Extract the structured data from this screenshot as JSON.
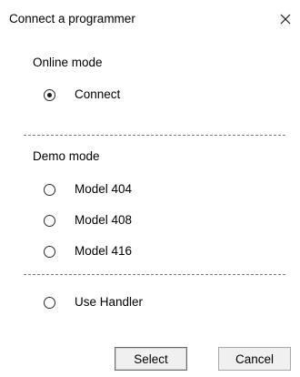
{
  "window": {
    "title": "Connect a programmer",
    "close_glyph": "✕"
  },
  "online": {
    "heading": "Online mode",
    "options": [
      {
        "label": "Connect",
        "selected": true
      }
    ]
  },
  "demo": {
    "heading": "Demo mode",
    "options": [
      {
        "label": "Model 404",
        "selected": false
      },
      {
        "label": "Model 408",
        "selected": false
      },
      {
        "label": "Model 416",
        "selected": false
      }
    ]
  },
  "handler": {
    "label": "Use Handler",
    "selected": false
  },
  "buttons": {
    "select": "Select",
    "cancel": "Cancel"
  },
  "colors": {
    "background": "#ffffff",
    "button_face": "#f0f0f0",
    "separator": "#7a7a7a"
  },
  "icons": {
    "close": "close-icon",
    "radio": "radio-button"
  }
}
